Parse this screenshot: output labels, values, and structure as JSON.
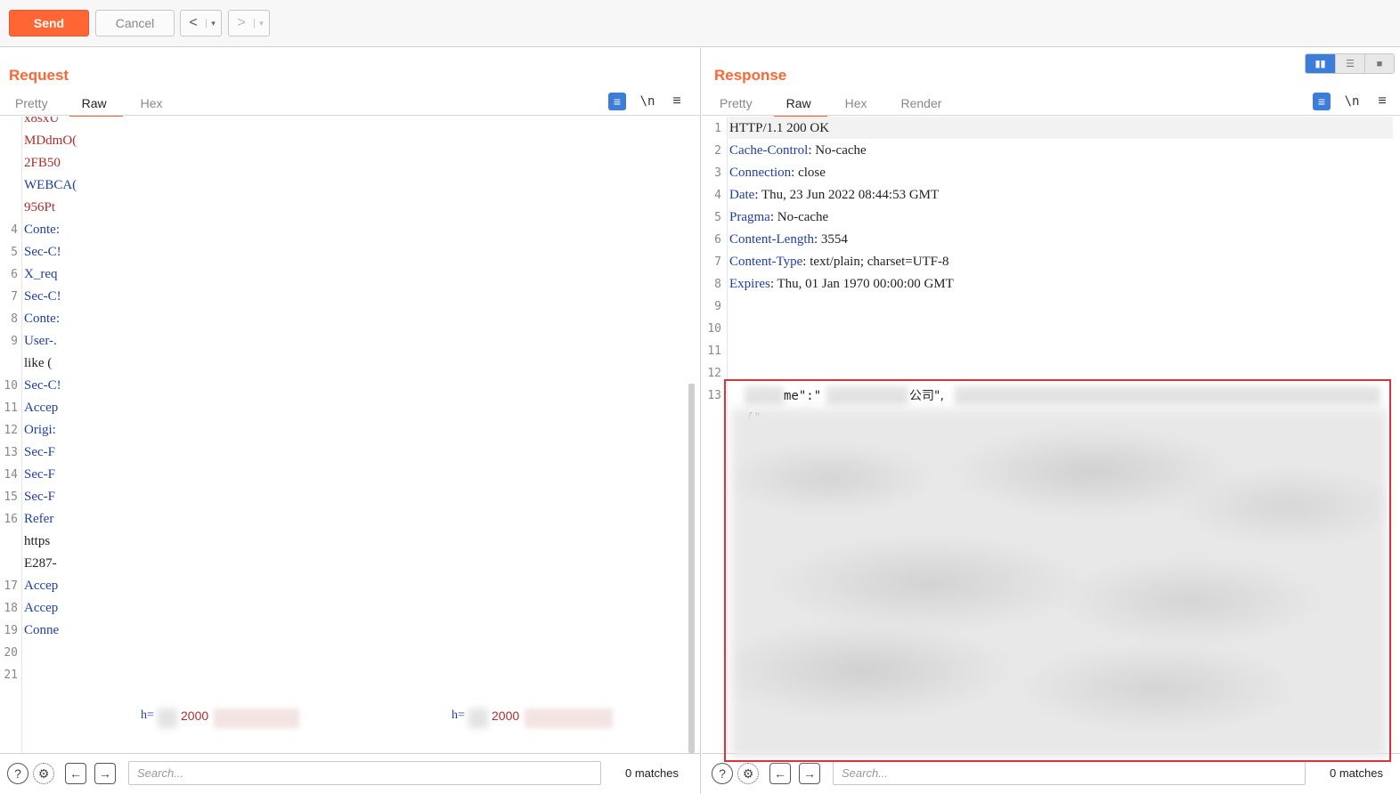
{
  "toolbar": {
    "send_label": "Send",
    "cancel_label": "Cancel",
    "back_glyph": "<",
    "forward_glyph": ">",
    "dropdown_glyph": "▾"
  },
  "request": {
    "title": "Request",
    "tabs": [
      "Pretty",
      "Raw",
      "Hex"
    ],
    "active_tab": "Raw",
    "lines": [
      {
        "n": "",
        "text": "x8sxU",
        "color": "red"
      },
      {
        "n": "",
        "text": "MDdmO(",
        "color": "red"
      },
      {
        "n": "",
        "text": "2FB50",
        "color": "red"
      },
      {
        "n": "",
        "text": "WEBCA(",
        "color": "blue"
      },
      {
        "n": "",
        "text": "956Pt",
        "color": "red"
      },
      {
        "n": "4",
        "text": "Conte:",
        "color": "blue"
      },
      {
        "n": "5",
        "text": "Sec-C!",
        "color": "blue"
      },
      {
        "n": "6",
        "text": "X_req",
        "color": "blue"
      },
      {
        "n": "7",
        "text": "Sec-C!",
        "color": "blue"
      },
      {
        "n": "8",
        "text": "Conte:",
        "color": "blue"
      },
      {
        "n": "9",
        "text": "User-.",
        "color": "blue"
      },
      {
        "n": "",
        "text": "like (",
        "color": "plain"
      },
      {
        "n": "10",
        "text": "Sec-C!",
        "color": "blue"
      },
      {
        "n": "11",
        "text": "Accep",
        "color": "blue"
      },
      {
        "n": "12",
        "text": "Origi:",
        "color": "blue"
      },
      {
        "n": "13",
        "text": "Sec-F",
        "color": "blue"
      },
      {
        "n": "14",
        "text": "Sec-F",
        "color": "blue"
      },
      {
        "n": "15",
        "text": "Sec-F",
        "color": "blue"
      },
      {
        "n": "16",
        "text": "Refer",
        "color": "blue"
      },
      {
        "n": "",
        "text": "https",
        "color": "plain"
      },
      {
        "n": "",
        "text": "E287-",
        "color": "plain"
      },
      {
        "n": "17",
        "text": "Accep",
        "color": "blue"
      },
      {
        "n": "18",
        "text": "Accep",
        "color": "blue"
      },
      {
        "n": "19",
        "text": "Conne",
        "color": "blue"
      },
      {
        "n": "20",
        "text": "",
        "color": "plain"
      },
      {
        "n": "21",
        "text": "",
        "color": "plain"
      }
    ],
    "body_fragment_a_key": "h=",
    "body_fragment_a_val": "2000",
    "body_fragment_b_key": "h=",
    "body_fragment_b_val": "2000",
    "search_placeholder": "Search...",
    "matches": "0 matches"
  },
  "response": {
    "title": "Response",
    "tabs": [
      "Pretty",
      "Raw",
      "Hex",
      "Render"
    ],
    "active_tab": "Raw",
    "lines": [
      {
        "n": "1",
        "key": "HTTP/1.1 200 OK",
        "sep": "",
        "val": ""
      },
      {
        "n": "2",
        "key": "Cache-Control",
        "sep": ":",
        "val": " No-cache"
      },
      {
        "n": "3",
        "key": "Connection",
        "sep": ":",
        "val": " close"
      },
      {
        "n": "4",
        "key": "Date",
        "sep": ":",
        "val": " Thu, 23 Jun 2022 08:44:53 GMT"
      },
      {
        "n": "5",
        "key": "Pragma",
        "sep": ":",
        "val": " No-cache"
      },
      {
        "n": "6",
        "key": "Content-Length",
        "sep": ":",
        "val": " 3554"
      },
      {
        "n": "7",
        "key": "Content-Type",
        "sep": ":",
        "val": " text/plain; charset=UTF-8"
      },
      {
        "n": "8",
        "key": "Expires",
        "sep": ":",
        "val": " Thu, 01 Jan 1970 00:00:00 GMT"
      },
      {
        "n": "9",
        "key": "",
        "sep": "",
        "val": ""
      },
      {
        "n": "10",
        "key": "",
        "sep": "",
        "val": ""
      },
      {
        "n": "11",
        "key": "",
        "sep": "",
        "val": ""
      },
      {
        "n": "12",
        "key": "",
        "sep": "",
        "val": ""
      },
      {
        "n": "13",
        "key": "",
        "sep": "",
        "val": ""
      }
    ],
    "body_open": "{\"",
    "body_key_tail": "me\":\"",
    "body_company": "公司\",",
    "search_placeholder": "Search...",
    "matches": "0 matches"
  },
  "colors": {
    "accent": "#ff6633",
    "highlight_frame": "#d9343b",
    "header_key": "#1f3ea8",
    "cookie_value": "#b22b2b"
  }
}
